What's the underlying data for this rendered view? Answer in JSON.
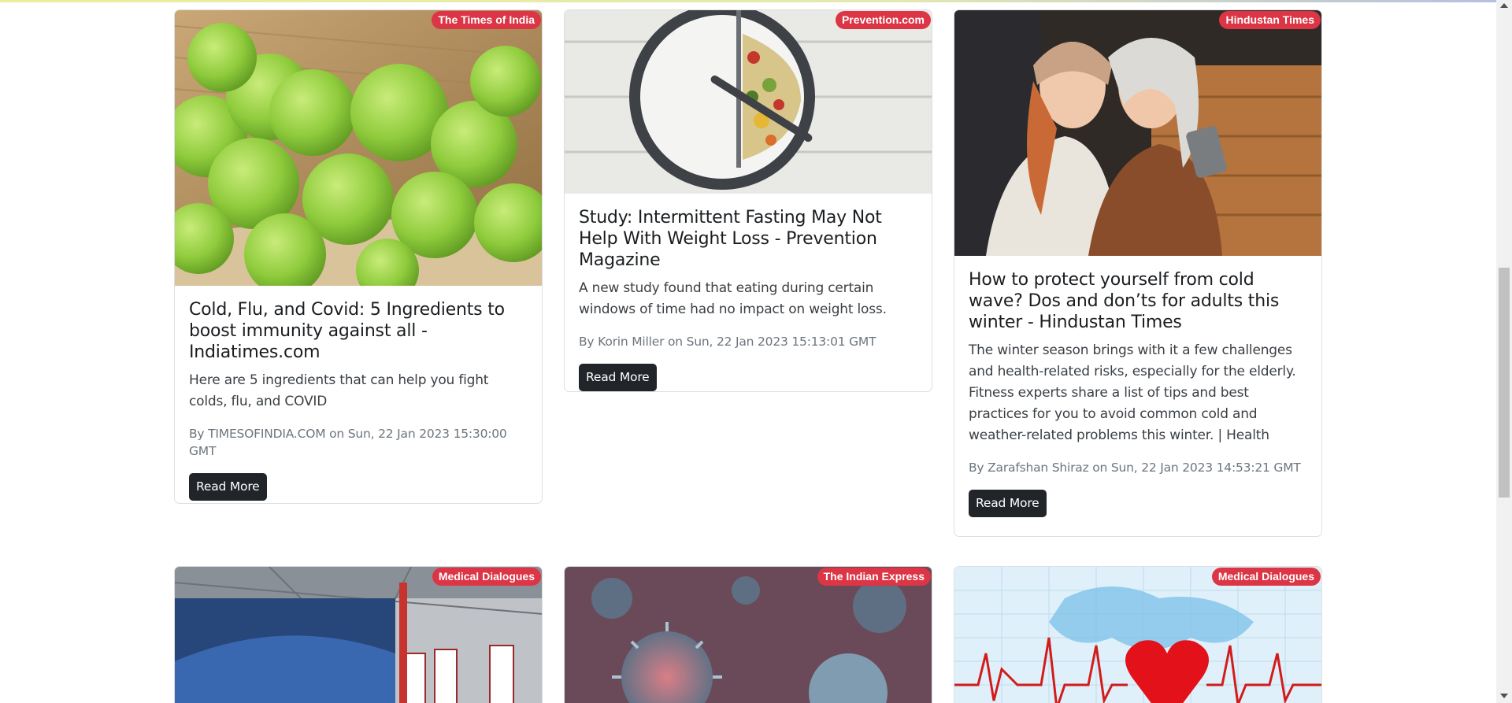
{
  "colors": {
    "badge": "#dc3545",
    "button": "#212529",
    "meta": "#6c757d"
  },
  "articles": [
    {
      "source": "The Times of India",
      "title": "Cold, Flu, and Covid: 5 Ingredients to boost immunity against all - Indiatimes.com",
      "description": "Here are 5 ingredients that can help you fight colds, flu, and COVID",
      "meta": "By TIMESOFINDIA.COM on Sun, 22 Jan 2023 15:30:00 GMT",
      "button": "Read More",
      "image": "amla-gooseberries-photo"
    },
    {
      "source": "Prevention.com",
      "title": "Study: Intermittent Fasting May Not Help With Weight Loss - Prevention Magazine",
      "description": "A new study found that eating during certain windows of time had no impact on weight loss.",
      "meta": "By Korin Miller on Sun, 22 Jan 2023 15:13:01 GMT",
      "button": "Read More",
      "image": "plate-clock-salad-photo"
    },
    {
      "source": "Hindustan Times",
      "title": "How to protect yourself from cold wave? Dos and don’ts for adults this winter - Hindustan Times",
      "description": "The winter season brings with it a few challenges and health-related risks, especially for the elderly. Fitness experts share a list of tips and best practices for you to avoid common cold and weather-related problems this winter. | Health",
      "meta": "By Zarafshan Shiraz on Sun, 22 Jan 2023 14:53:21 GMT",
      "button": "Read More",
      "image": "women-selfie-winter-photo"
    },
    {
      "source": "Medical Dialogues",
      "image": "stadium-banners-photo"
    },
    {
      "source": "The Indian Express",
      "image": "virus-particles-photo"
    },
    {
      "source": "Medical Dialogues",
      "image": "heart-ecg-map-photo"
    }
  ]
}
